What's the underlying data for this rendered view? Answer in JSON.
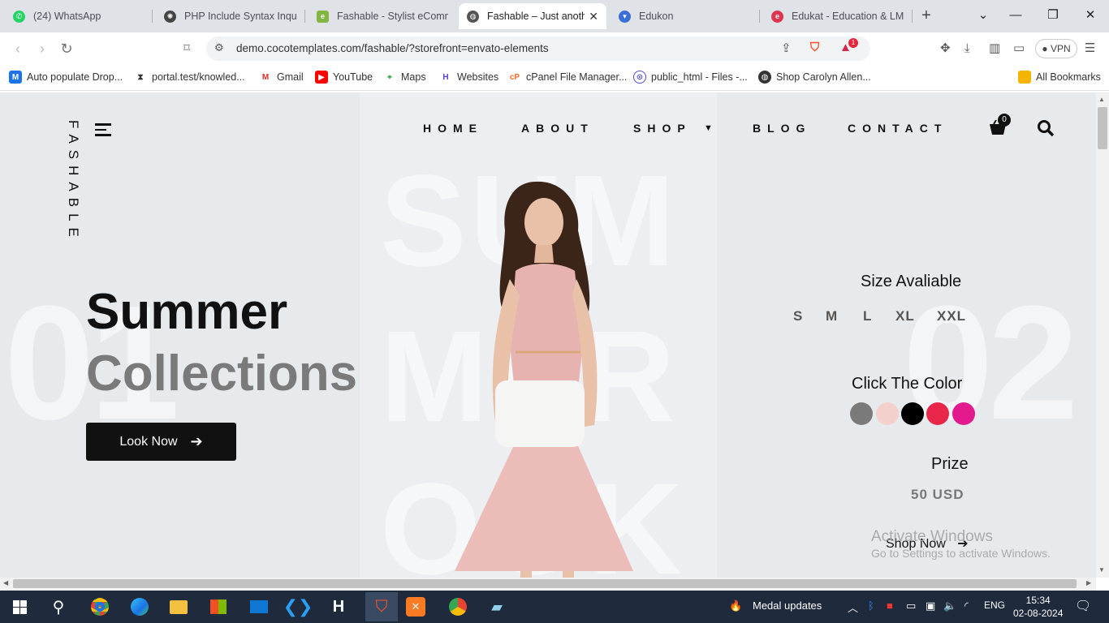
{
  "browser": {
    "tabs": [
      {
        "title": "(24) WhatsApp",
        "icon": "whatsapp-icon"
      },
      {
        "title": "PHP Include Syntax Inquiry",
        "icon": "chatgpt-icon"
      },
      {
        "title": "Fashable - Stylist eCommerce",
        "icon": "envato-icon"
      },
      {
        "title": "Fashable – Just another",
        "icon": "globe-icon",
        "active": true
      },
      {
        "title": "Edukon",
        "icon": "edukon-icon"
      },
      {
        "title": "Edukat - Education & LMS",
        "icon": "edukat-icon"
      }
    ],
    "url": "demo.cocotemplates.com/fashable/?storefront=envato-elements",
    "vpn_label": "VPN",
    "brave_badge": "1",
    "bookmarks": [
      {
        "label": "Auto populate Drop...",
        "icon": "m-icon"
      },
      {
        "label": "portal.test/knowled...",
        "icon": "portal-icon"
      },
      {
        "label": "Gmail",
        "icon": "gmail-icon"
      },
      {
        "label": "YouTube",
        "icon": "youtube-icon"
      },
      {
        "label": "Maps",
        "icon": "maps-icon"
      },
      {
        "label": "Websites",
        "icon": "websites-icon"
      },
      {
        "label": "cPanel File Manager...",
        "icon": "cpanel-icon"
      },
      {
        "label": "public_html - Files -...",
        "icon": "files-icon"
      },
      {
        "label": "Shop Carolyn Allen...",
        "icon": "globe-icon"
      }
    ],
    "all_bookmarks": "All Bookmarks"
  },
  "site": {
    "brand": "FASHABLE",
    "nav": [
      "HOME",
      "ABOUT",
      "SHOP",
      "BLOG",
      "CONTACT"
    ],
    "cart_count": "0",
    "number_left": "01",
    "number_right": "02",
    "bg_words": [
      "SUM",
      "MER",
      "OOK"
    ],
    "headline_1": "Summer",
    "headline_2": "Collections",
    "cta": "Look Now",
    "size_label": "Size Avaliable",
    "sizes": [
      "S",
      "M",
      "L",
      "XL",
      "XXL"
    ],
    "color_label": "Click The Color",
    "colors": [
      "#7a7a7a",
      "#f4d0cc",
      "#000000",
      "#e8274b",
      "#e31a8e"
    ],
    "price_label": "Prize",
    "price": "50 USD",
    "shop_now": "Shop Now"
  },
  "watermark": {
    "line1": "Activate Windows",
    "line2": "Go to Settings to activate Windows."
  },
  "taskbar": {
    "medal": "Medal updates",
    "lang": "ENG",
    "time": "15:34",
    "date": "02-08-2024"
  }
}
